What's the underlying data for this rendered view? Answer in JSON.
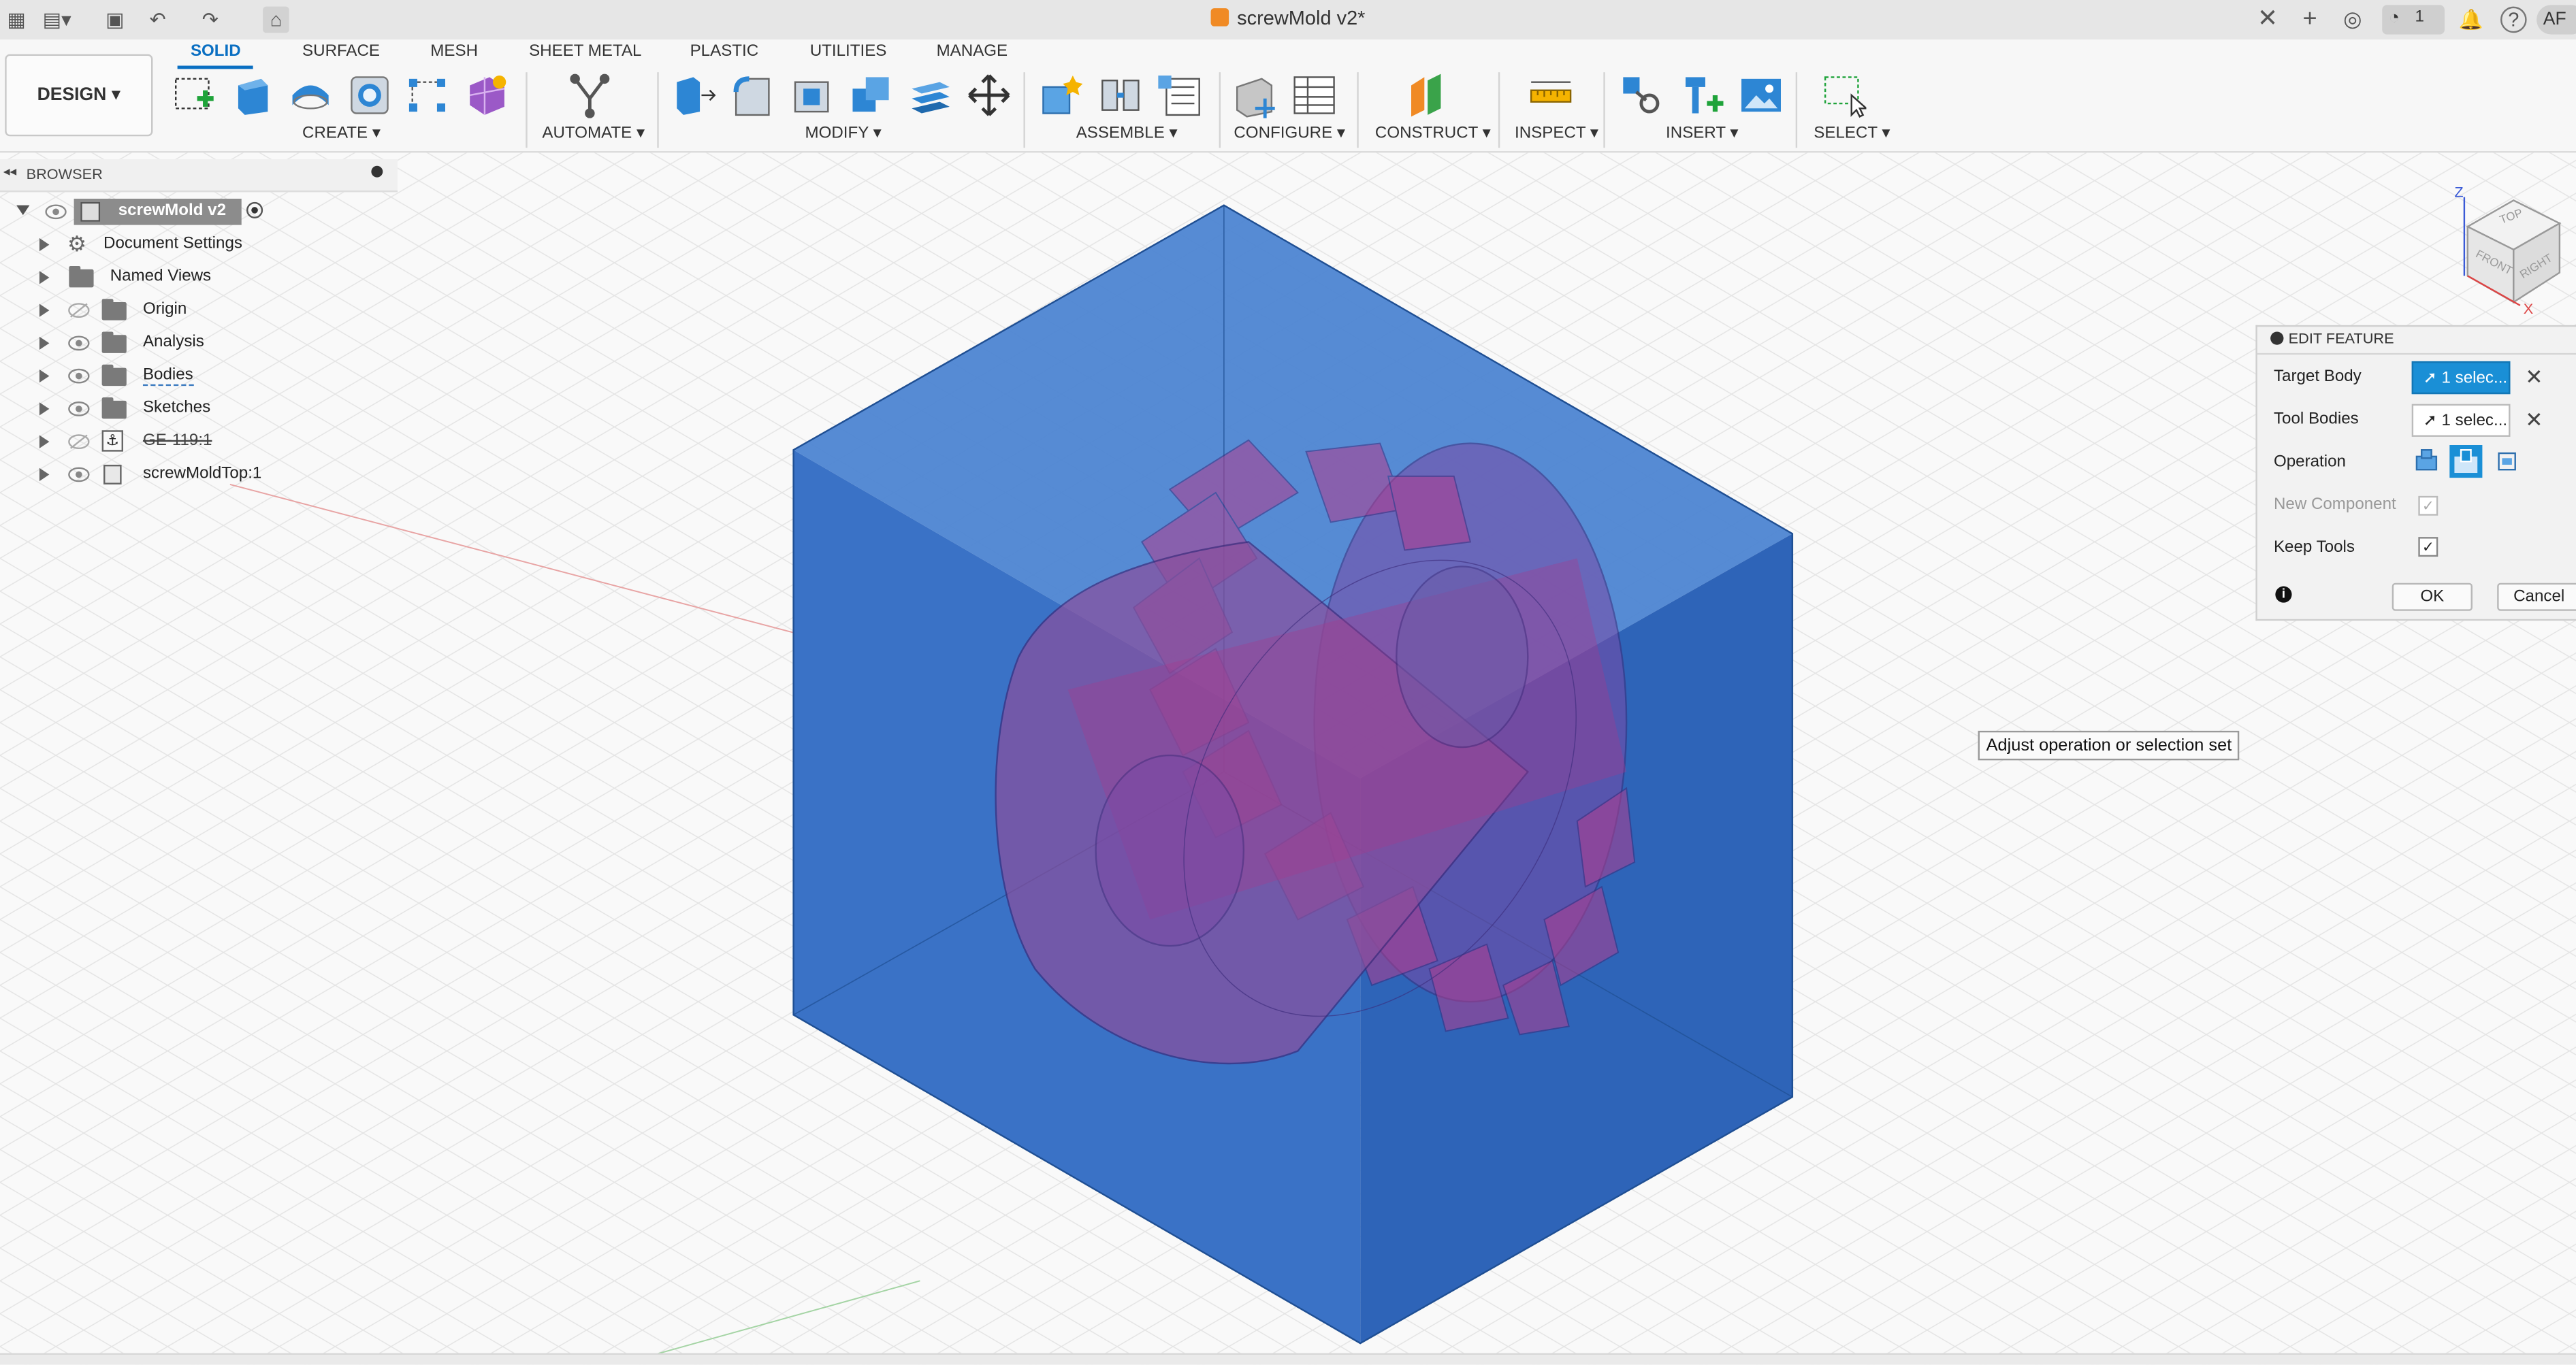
{
  "titlebar": {
    "document_title": "screwMold v2*",
    "notification_count": "1",
    "user_initials": "AF",
    "brand_color": "#f08a24"
  },
  "toolbar": {
    "workspace_label": "DESIGN",
    "tabs": [
      "SOLID",
      "SURFACE",
      "MESH",
      "SHEET METAL",
      "PLASTIC",
      "UTILITIES",
      "MANAGE"
    ],
    "active_tab": "SOLID",
    "groups": {
      "create": "CREATE",
      "automate": "AUTOMATE",
      "modify": "MODIFY",
      "assemble": "ASSEMBLE",
      "configure": "CONFIGURE",
      "construct": "CONSTRUCT",
      "inspect": "INSPECT",
      "insert": "INSERT",
      "select": "SELECT"
    },
    "accent_color": "#0a6fc2"
  },
  "browser": {
    "header": "BROWSER",
    "root": "screwMold v2",
    "items": [
      {
        "label": "Document Settings",
        "icon": "gear-icon"
      },
      {
        "label": "Named Views",
        "icon": "folder-icon"
      },
      {
        "label": "Origin",
        "icon": "folder-icon",
        "visible": false
      },
      {
        "label": "Analysis",
        "icon": "folder-icon"
      },
      {
        "label": "Bodies",
        "icon": "folder-icon"
      },
      {
        "label": "Sketches",
        "icon": "folder-icon"
      },
      {
        "label": "GE-119:1",
        "icon": "component-link-icon",
        "visible": false
      },
      {
        "label": "screwMoldTop:1",
        "icon": "component-icon"
      }
    ]
  },
  "viewcube": {
    "top": "TOP",
    "front": "FRONT",
    "right": "RIGHT",
    "axis_z": "Z",
    "axis_x": "X"
  },
  "edit_feature": {
    "title": "EDIT FEATURE",
    "target_body_label": "Target Body",
    "target_body_value": "1 selec...",
    "tool_bodies_label": "Tool Bodies",
    "tool_bodies_value": "1 selec...",
    "operation_label": "Operation",
    "new_component_label": "New Component",
    "keep_tools_label": "Keep Tools",
    "ok_label": "OK",
    "cancel_label": "Cancel",
    "selected_color": "#1a8fd6"
  },
  "tooltip": "Adjust operation or selection set",
  "model_colors": {
    "body": "#2f6fc4",
    "tool_body": "#9a3f9a"
  }
}
